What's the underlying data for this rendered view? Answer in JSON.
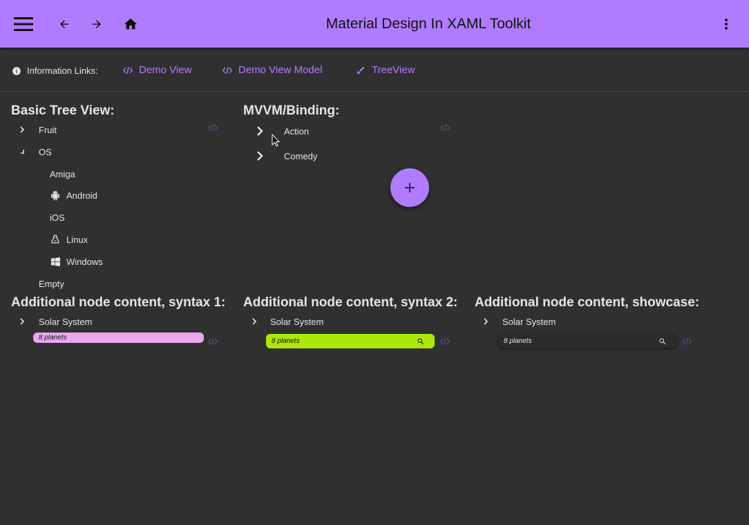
{
  "appbar": {
    "title": "Material Design In XAML Toolkit",
    "icons": [
      "menu-icon",
      "arrow-back-icon",
      "arrow-forward-icon",
      "home-icon",
      "more-vert-icon"
    ],
    "color": "#b07cff"
  },
  "info": {
    "label": "Information Links:",
    "links": [
      {
        "label": "Demo View",
        "icon": "code-icon"
      },
      {
        "label": "Demo View Model",
        "icon": "code-icon"
      },
      {
        "label": "TreeView",
        "icon": "brush-icon"
      }
    ]
  },
  "basic": {
    "title": "Basic Tree View:",
    "fruit": "Fruit",
    "os": "OS",
    "os_items": [
      {
        "label": "Amiga",
        "icon": ""
      },
      {
        "label": "Android",
        "icon": "android-icon"
      },
      {
        "label": "iOS",
        "icon": ""
      },
      {
        "label": "Linux",
        "icon": "linux-icon"
      },
      {
        "label": "Windows",
        "icon": "windows-icon"
      }
    ],
    "empty": "Empty"
  },
  "mvvm": {
    "title": "MVVM/Binding:",
    "items": [
      "Action",
      "Comedy"
    ]
  },
  "syntax1": {
    "title": "Additional node content, syntax 1:",
    "node": "Solar System",
    "pill": "8 planets",
    "pill_color": "#e9a8f0"
  },
  "syntax2": {
    "title": "Additional node content, syntax 2:",
    "node": "Solar System",
    "pill": "8 planets",
    "pill_color": "#ade60a"
  },
  "showcase": {
    "title": "Additional node content, showcase:",
    "node": "Solar System",
    "pill": "8 planets",
    "pill_color": "#2b2b2b"
  }
}
